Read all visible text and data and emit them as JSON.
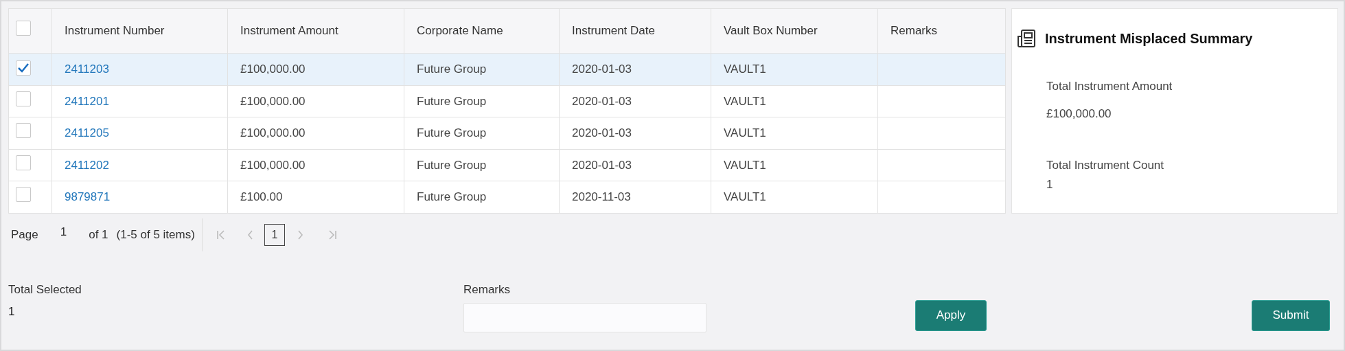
{
  "table": {
    "select_all": {
      "checked": false
    },
    "columns": [
      "Instrument Number",
      "Instrument Amount",
      "Corporate Name",
      "Instrument Date",
      "Vault Box Number",
      "Remarks"
    ],
    "rows": [
      {
        "selected": true,
        "cells": [
          "2411203",
          "£100,000.00",
          "Future Group",
          "2020-01-03",
          "VAULT1",
          ""
        ]
      },
      {
        "selected": false,
        "cells": [
          "2411201",
          "£100,000.00",
          "Future Group",
          "2020-01-03",
          "VAULT1",
          ""
        ]
      },
      {
        "selected": false,
        "cells": [
          "2411205",
          "£100,000.00",
          "Future Group",
          "2020-01-03",
          "VAULT1",
          ""
        ]
      },
      {
        "selected": false,
        "cells": [
          "2411202",
          "£100,000.00",
          "Future Group",
          "2020-01-03",
          "VAULT1",
          ""
        ]
      },
      {
        "selected": false,
        "cells": [
          "9879871",
          "£100.00",
          "Future Group",
          "2020-11-03",
          "VAULT1",
          ""
        ]
      }
    ]
  },
  "pagination": {
    "page_label": "Page",
    "page": "1",
    "of": "of 1",
    "range": "(1-5 of 5 items)",
    "current_page": "1"
  },
  "summary": {
    "title": "Instrument Misplaced Summary",
    "fields": [
      {
        "label": "Total Instrument Amount",
        "value": "£100,000.00"
      },
      {
        "label": "Total Instrument Count",
        "value": "1"
      }
    ]
  },
  "total_selected": {
    "label": "Total Selected",
    "value": "1"
  },
  "remarks": {
    "label": "Remarks"
  },
  "buttons": [
    "Apply",
    "Submit"
  ]
}
